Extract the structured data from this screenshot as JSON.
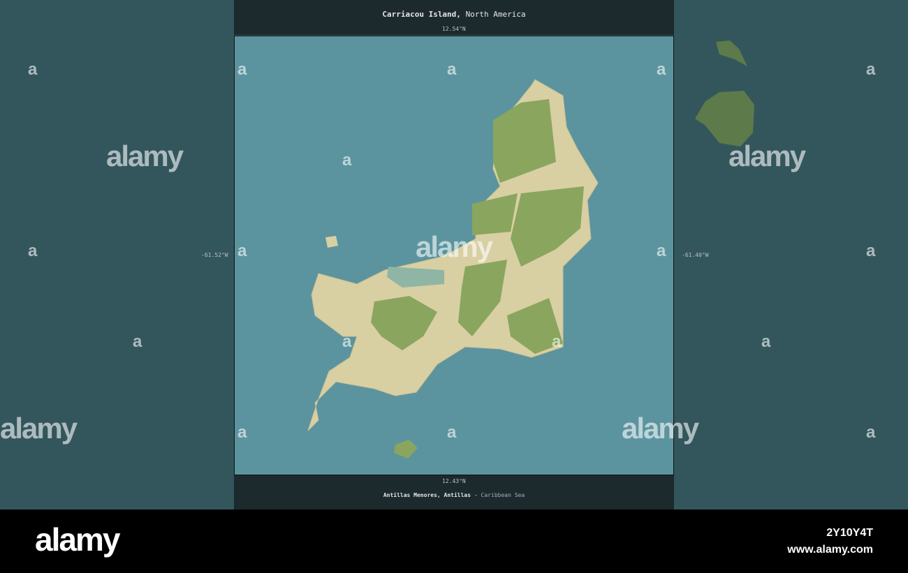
{
  "title": {
    "place": "Carriacou Island,",
    "region": "North America"
  },
  "coords": {
    "top": "12.54°N",
    "bottom": "12.43°N",
    "left": "-61.52°W",
    "right": "-61.40°W"
  },
  "subtitle": {
    "area": "Antillas Menores, Antillas",
    "separator": "-",
    "sea": "Caribbean Sea"
  },
  "watermark": {
    "text": "alamy",
    "short": "a"
  },
  "footer": {
    "logo": "alamy",
    "image_id": "2Y10Y4T",
    "url": "www.alamy.com"
  },
  "colors": {
    "sea": "#5b949e",
    "land": "#d8cfa3",
    "forest": "#8aa55e",
    "outer": "#33565d"
  }
}
